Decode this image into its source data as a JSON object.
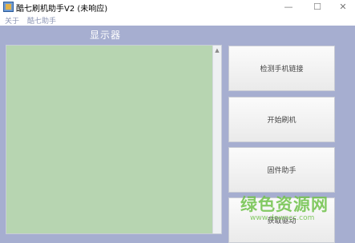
{
  "window": {
    "title": "酷七刷机助手V2 (未响应)",
    "minimize_glyph": "—",
    "maximize_glyph": "☐",
    "close_glyph": "✕"
  },
  "menu": {
    "items": [
      "关于",
      "酷七助手"
    ]
  },
  "display": {
    "label": "显示器",
    "scroll_up_glyph": "▲"
  },
  "actions": [
    {
      "label": "检测手机链接"
    },
    {
      "label": "开始刷机"
    },
    {
      "label": "固件助手"
    },
    {
      "label": "获取驱动"
    }
  ],
  "watermark": {
    "text": "绿色资源网",
    "url": "www.downcc.com"
  },
  "colors": {
    "background": "#a6aed0",
    "display_panel": "#b7d5b1",
    "watermark": "#6fc24a"
  }
}
